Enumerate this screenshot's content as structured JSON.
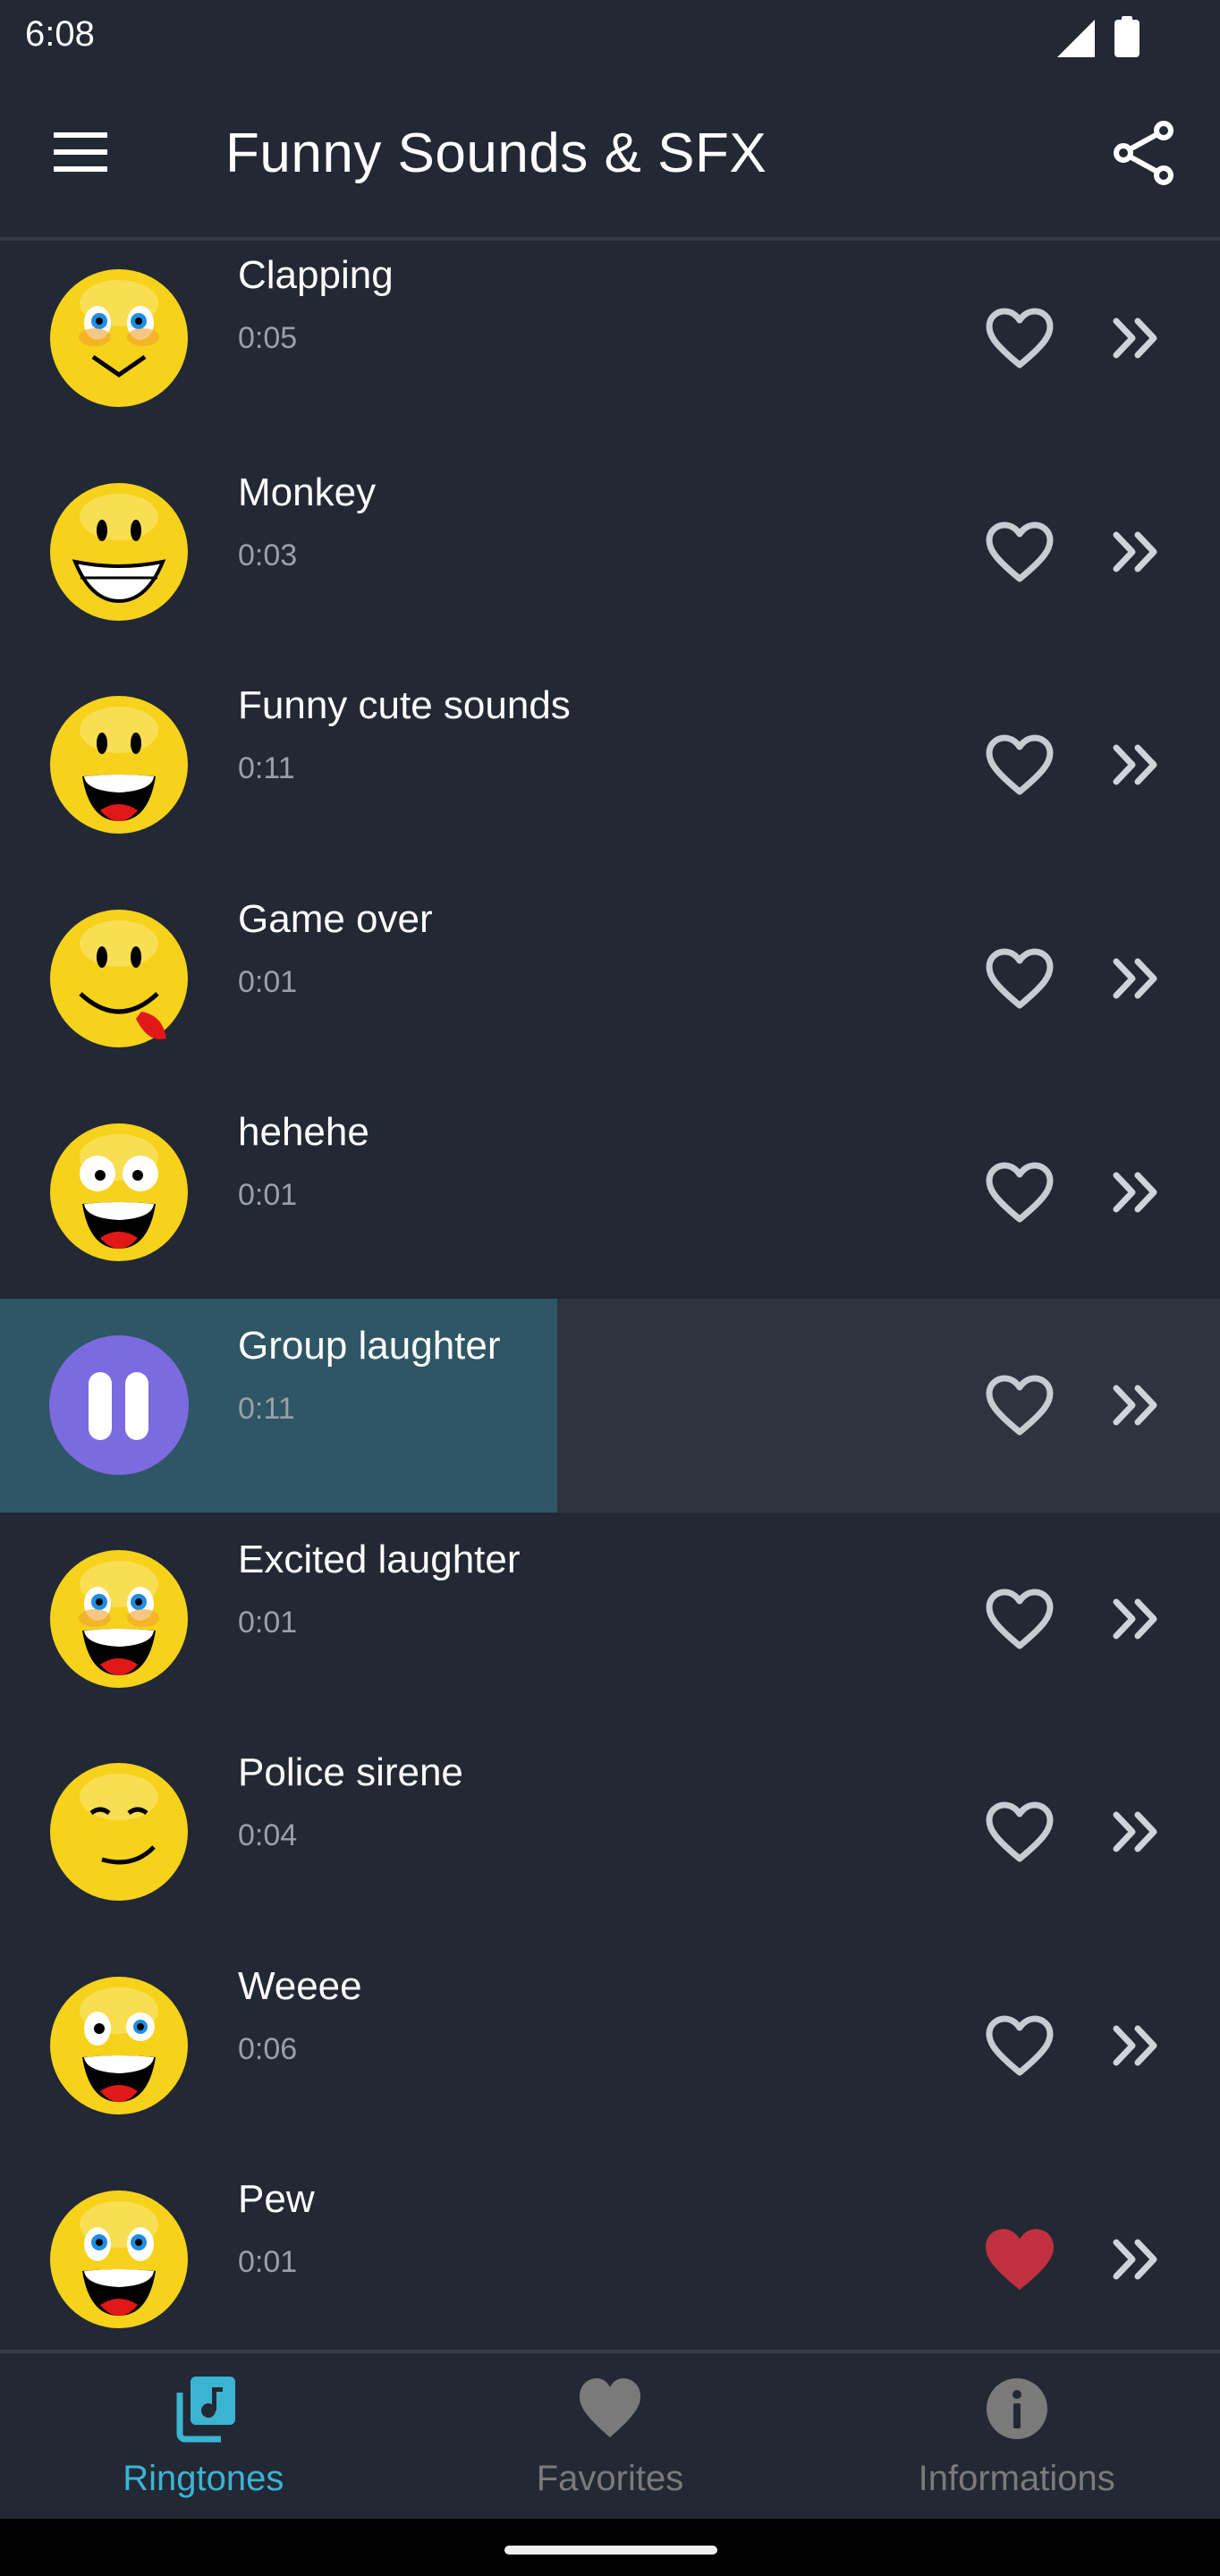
{
  "status_bar": {
    "time": "6:08",
    "icons": [
      "signal-icon",
      "battery-icon"
    ]
  },
  "app_bar": {
    "menu_icon": "hamburger-menu-icon",
    "title": "Funny Sounds & SFX",
    "share_icon": "share-icon"
  },
  "sounds": [
    {
      "name": "Clapping",
      "duration": "0:05",
      "favorite": false,
      "playing": false,
      "face": "blush"
    },
    {
      "name": "Monkey",
      "duration": "0:03",
      "favorite": false,
      "playing": false,
      "face": "grin-teeth"
    },
    {
      "name": "Funny cute sounds",
      "duration": "0:11",
      "favorite": false,
      "playing": false,
      "face": "laugh"
    },
    {
      "name": "Game over",
      "duration": "0:01",
      "favorite": false,
      "playing": false,
      "face": "tongue"
    },
    {
      "name": "hehehe",
      "duration": "0:01",
      "favorite": false,
      "playing": false,
      "face": "crazy"
    },
    {
      "name": "Group laughter",
      "duration": "0:11",
      "favorite": false,
      "playing": true,
      "progress_percent": 45.7,
      "face": "pause"
    },
    {
      "name": "Excited laughter",
      "duration": "0:01",
      "favorite": false,
      "playing": false,
      "face": "blush-laugh"
    },
    {
      "name": "Police sirene",
      "duration": "0:04",
      "favorite": false,
      "playing": false,
      "face": "smirk"
    },
    {
      "name": "Weeee",
      "duration": "0:06",
      "favorite": false,
      "playing": false,
      "face": "wink-laugh"
    },
    {
      "name": "Pew",
      "duration": "0:01",
      "favorite": true,
      "playing": false,
      "face": "laugh-big"
    }
  ],
  "bottom_nav": {
    "items": [
      {
        "label": "Ringtones",
        "icon": "music-library-icon",
        "active": true
      },
      {
        "label": "Favorites",
        "icon": "heart-icon",
        "active": false
      },
      {
        "label": "Informations",
        "icon": "info-icon",
        "active": false
      }
    ]
  },
  "colors": {
    "background": "#222834",
    "accent": "#3bb4d4",
    "inactive": "#7a7a7a",
    "favorite": "#c0303e",
    "play_button": "#7b6ae0",
    "progress_fill": "#2e5664",
    "playing_row": "#2d333f",
    "emoji_yellow": "#f7d21a"
  }
}
